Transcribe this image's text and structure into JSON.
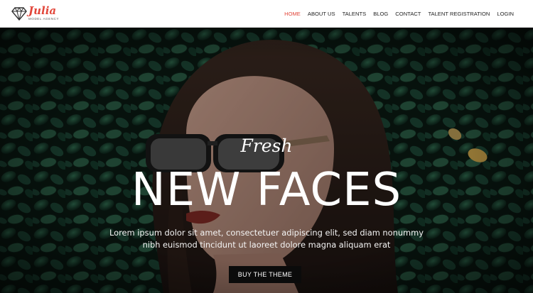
{
  "brand": {
    "name": "Julia",
    "tagline": "MODEL AGENCY",
    "logo_icon": "diamond-icon",
    "accent_color": "#e2473b"
  },
  "nav": {
    "items": [
      {
        "label": "HOME",
        "active": true
      },
      {
        "label": "ABOUT US",
        "active": false
      },
      {
        "label": "TALENTS",
        "active": false
      },
      {
        "label": "BLOG",
        "active": false
      },
      {
        "label": "CONTACT",
        "active": false
      },
      {
        "label": "TALENT REGISTRATION",
        "active": false
      },
      {
        "label": "LOGIN",
        "active": false
      }
    ]
  },
  "hero": {
    "kicker": "Fresh",
    "headline": "NEW FACES",
    "subtext": "Lorem ipsum dolor sit amet, consectetuer adipiscing elit, sed diam nonummy nibh euismod tincidunt ut laoreet dolore magna aliquam erat",
    "cta_label": "BUY THE THEME"
  }
}
